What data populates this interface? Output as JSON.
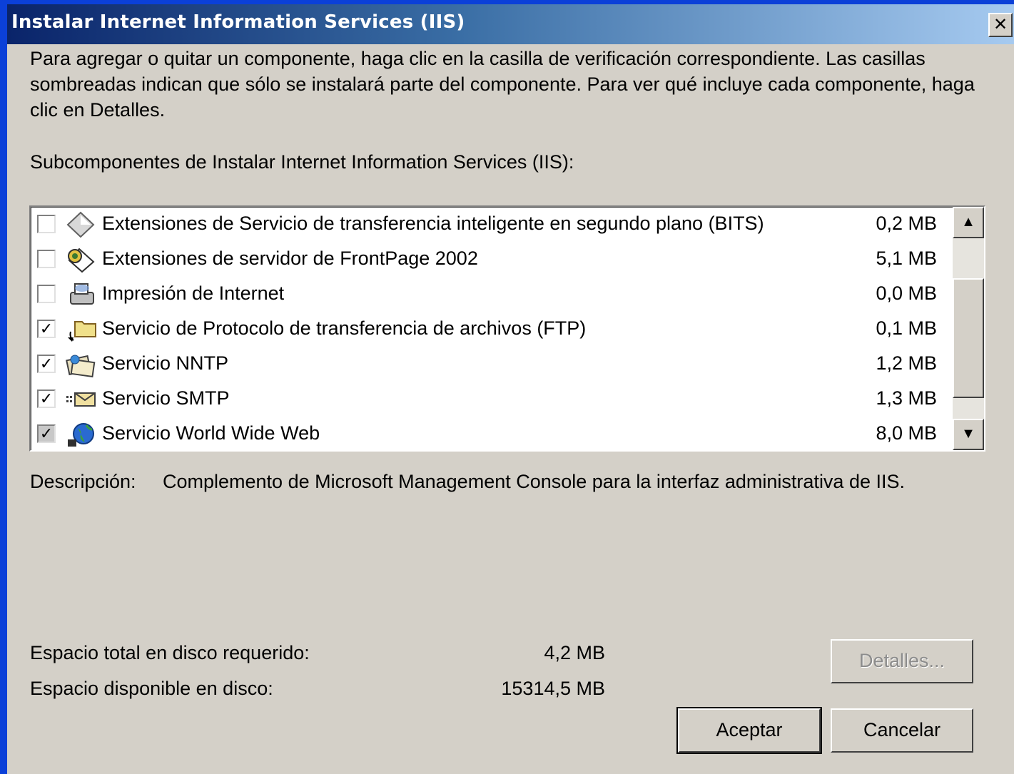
{
  "window": {
    "title": "Instalar Internet Information Services (IIS)",
    "close_glyph": "✕"
  },
  "intro_text": "Para agregar o quitar un componente, haga clic en la casilla de verificación correspondiente. Las casillas sombreadas indican que sólo se instalará parte del componente. Para ver qué incluye cada componente, haga clic en Detalles.",
  "subcomponents_label": "Subcomponentes de Instalar Internet Information Services (IIS):",
  "components": [
    {
      "name": "Extensiones de Servicio de transferencia inteligente en segundo plano (BITS)",
      "size": "0,2 MB",
      "state": "unchecked",
      "check_glyph": "",
      "icon": "diamond-icon"
    },
    {
      "name": "Extensiones de servidor de FrontPage 2002",
      "size": "5,1 MB",
      "state": "unchecked",
      "check_glyph": "",
      "icon": "frontpage-icon"
    },
    {
      "name": "Impresión de Internet",
      "size": "0,0 MB",
      "state": "unchecked",
      "check_glyph": "",
      "icon": "printer-icon"
    },
    {
      "name": "Servicio de Protocolo de transferencia de archivos (FTP)",
      "size": "0,1 MB",
      "state": "checked",
      "check_glyph": "✓",
      "icon": "folder-icon"
    },
    {
      "name": "Servicio NNTP",
      "size": "1,2 MB",
      "state": "checked",
      "check_glyph": "✓",
      "icon": "news-icon"
    },
    {
      "name": "Servicio SMTP",
      "size": "1,3 MB",
      "state": "checked",
      "check_glyph": "✓",
      "icon": "mail-icon"
    },
    {
      "name": "Servicio World Wide Web",
      "size": "8,0 MB",
      "state": "partial",
      "check_glyph": "✓",
      "icon": "globe-icon"
    }
  ],
  "scrollbar": {
    "up_glyph": "▲",
    "down_glyph": "▼"
  },
  "description": {
    "label": "Descripción:",
    "text": "Complemento de Microsoft Management Console para la interfaz administrativa de IIS."
  },
  "disk": {
    "required_label": "Espacio total en disco requerido:",
    "required_value": "4,2 MB",
    "available_label": "Espacio disponible en disco:",
    "available_value": "15314,5 MB"
  },
  "buttons": {
    "details": "Detalles...",
    "ok": "Aceptar",
    "cancel": "Cancelar"
  }
}
